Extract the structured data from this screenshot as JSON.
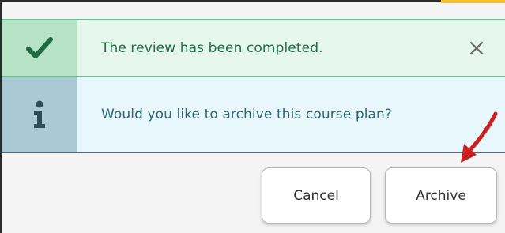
{
  "success_banner": {
    "message": "The review has been completed.",
    "icon": "checkmark-icon",
    "close_icon": "close-icon",
    "colors": {
      "background": "#e5f7ed",
      "icon_cell": "#b6e2c6",
      "icon": "#1f6a3f",
      "text": "#1f6e44"
    }
  },
  "info_banner": {
    "message": "Would you like to archive this course plan?",
    "icon": "info-icon",
    "colors": {
      "background": "#e7f7fb",
      "icon_cell": "#a9c9d4",
      "icon": "#2b4c59",
      "text": "#2d6577"
    }
  },
  "actions": {
    "cancel_label": "Cancel",
    "archive_label": "Archive"
  },
  "annotation": {
    "icon": "red-arrow-icon",
    "color": "#cc1f1f"
  }
}
